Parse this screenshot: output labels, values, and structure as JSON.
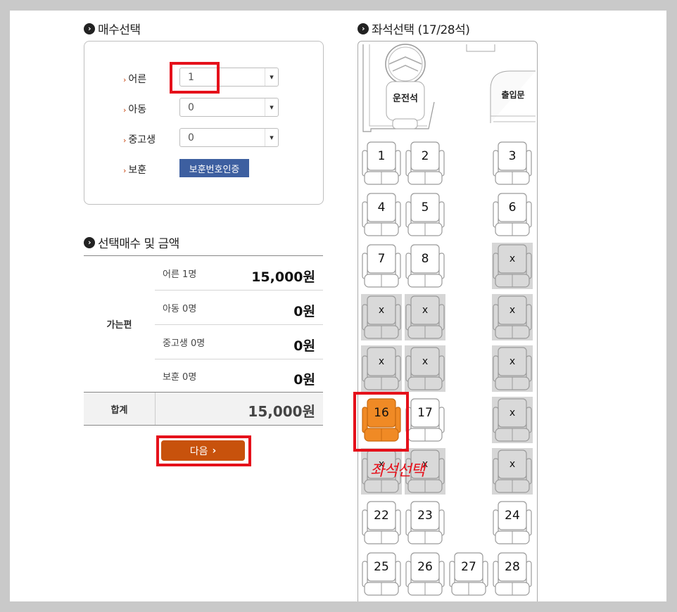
{
  "ticket_count": {
    "title": "매수선택",
    "rows": [
      {
        "label": "어른",
        "value": "1"
      },
      {
        "label": "아동",
        "value": "0"
      },
      {
        "label": "중고생",
        "value": "0"
      },
      {
        "label": "보훈",
        "button": "보훈번호인증"
      }
    ]
  },
  "seat_select": {
    "title": "좌석선택 (17/28석)",
    "driver_label": "운전석",
    "door_label": "출입문",
    "overlay_text": "좌석선택",
    "seats": [
      {
        "label": "1",
        "status": "available"
      },
      {
        "label": "2",
        "status": "available"
      },
      {
        "label": "3",
        "status": "available"
      },
      {
        "label": "4",
        "status": "available"
      },
      {
        "label": "5",
        "status": "available"
      },
      {
        "label": "6",
        "status": "available"
      },
      {
        "label": "7",
        "status": "available"
      },
      {
        "label": "8",
        "status": "available"
      },
      {
        "label": "x",
        "status": "taken"
      },
      {
        "label": "x",
        "status": "taken"
      },
      {
        "label": "x",
        "status": "taken"
      },
      {
        "label": "x",
        "status": "taken"
      },
      {
        "label": "x",
        "status": "taken"
      },
      {
        "label": "x",
        "status": "taken"
      },
      {
        "label": "x",
        "status": "taken"
      },
      {
        "label": "16",
        "status": "selected"
      },
      {
        "label": "17",
        "status": "available"
      },
      {
        "label": "x",
        "status": "taken"
      },
      {
        "label": "x",
        "status": "taken"
      },
      {
        "label": "x",
        "status": "taken"
      },
      {
        "label": "x",
        "status": "taken"
      },
      {
        "label": "22",
        "status": "available"
      },
      {
        "label": "23",
        "status": "available"
      },
      {
        "label": "24",
        "status": "available"
      },
      {
        "label": "25",
        "status": "available"
      },
      {
        "label": "26",
        "status": "available"
      },
      {
        "label": "27",
        "status": "available"
      },
      {
        "label": "28",
        "status": "available"
      }
    ]
  },
  "summary": {
    "title": "선택매수 및 금액",
    "direction": "가는편",
    "lines": [
      {
        "label": "어른 1명",
        "amount": "15,000원"
      },
      {
        "label": "아동 0명",
        "amount": "0원"
      },
      {
        "label": "중고생 0명",
        "amount": "0원"
      },
      {
        "label": "보훈 0명",
        "amount": "0원"
      }
    ],
    "total_label": "합계",
    "total_amount": "15,000원"
  },
  "next_button": "다음",
  "colors": {
    "selected_seat": "#f08a25",
    "taken_seat": "#d9d9d9",
    "highlight": "#e5111b",
    "next_button": "#c8520c",
    "merit_button": "#3d5fa0"
  }
}
